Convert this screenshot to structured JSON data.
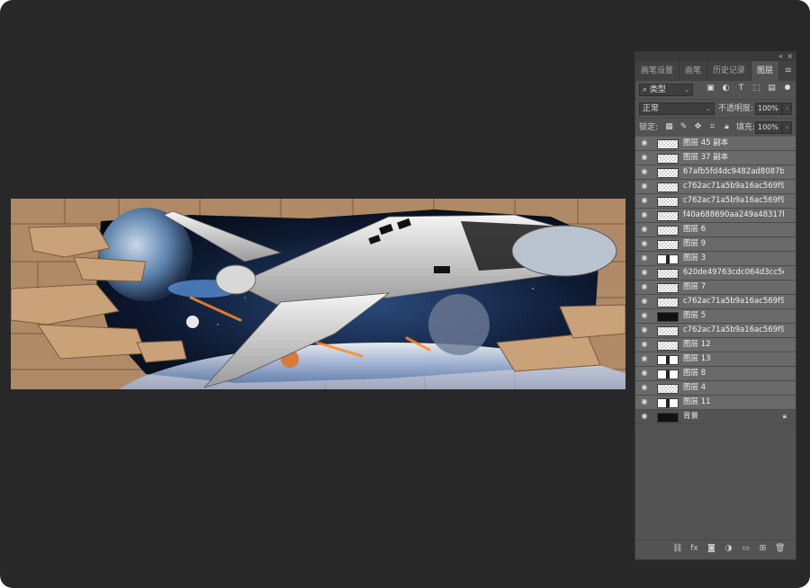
{
  "panel": {
    "tabs": [
      {
        "label": "画笔设置",
        "active": false
      },
      {
        "label": "画笔",
        "active": false
      },
      {
        "label": "历史记录",
        "active": false
      },
      {
        "label": "图层",
        "active": true
      }
    ],
    "filter": {
      "value": "类型"
    },
    "blend_mode": {
      "value": "正常"
    },
    "opacity": {
      "label": "不透明度:",
      "value": "100%"
    },
    "lock": {
      "label": "锁定:"
    },
    "fill": {
      "label": "填充:",
      "value": "100%"
    },
    "layers": [
      {
        "name": "图层 45 副本",
        "thumb": "checker"
      },
      {
        "name": "图层 37 副本",
        "thumb": "checker"
      },
      {
        "name": "67afb5fd4dc9482ad8087ba...",
        "thumb": "checker"
      },
      {
        "name": "c762ac71a5b9a16ac569f96...",
        "thumb": "checker"
      },
      {
        "name": "c762ac71a5b9a16ac569f96...",
        "thumb": "checker"
      },
      {
        "name": "f40a688690aa249a48317b...",
        "thumb": "checker"
      },
      {
        "name": "图层 6",
        "thumb": "checker"
      },
      {
        "name": "图层 9",
        "thumb": "checker"
      },
      {
        "name": "图层 3",
        "thumb": "mix"
      },
      {
        "name": "620de49763cdc064d3cc5e...",
        "thumb": "checker"
      },
      {
        "name": "图层 7",
        "thumb": "checker"
      },
      {
        "name": "c762ac71a5b9a16ac569f96...",
        "thumb": "checker"
      },
      {
        "name": "图层 5",
        "thumb": "dark"
      },
      {
        "name": "c762ac71a5b9a16ac569f96...",
        "thumb": "checker"
      },
      {
        "name": "图层 12",
        "thumb": "checker"
      },
      {
        "name": "图层 13",
        "thumb": "mix"
      },
      {
        "name": "图层 8",
        "thumb": "mix"
      },
      {
        "name": "图层 4",
        "thumb": "checker"
      },
      {
        "name": "图层 11",
        "thumb": "mix"
      }
    ],
    "background_layer": {
      "name": "背景"
    }
  },
  "icons": {
    "visibility": "eye-icon",
    "lock": "lock-icon",
    "search": "search-icon"
  },
  "colors": {
    "app_bg": "#282828",
    "panel_bg": "#535353",
    "layer_row": "#6a6a6a"
  }
}
